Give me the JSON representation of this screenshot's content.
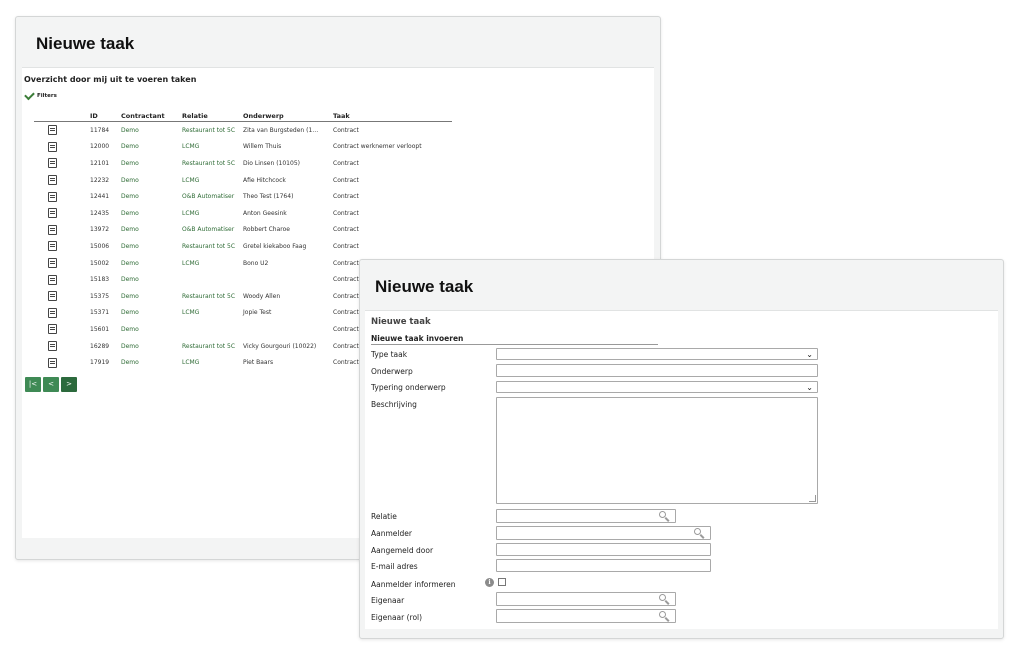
{
  "list_window": {
    "title": "Nieuwe taak",
    "overview_title": "Overzicht door mij uit te voeren taken",
    "filters_label": "Filters",
    "columns": [
      "",
      "ID",
      "Contractant",
      "Relatie",
      "Onderwerp",
      "Taak"
    ],
    "rows": [
      {
        "id": "11784",
        "contractant": "Demo",
        "relatie": "Restaurant tot 5C",
        "onderwerp": "Zita van Burgsteden (1…",
        "taak": "Contract"
      },
      {
        "id": "12000",
        "contractant": "Demo",
        "relatie": "LCMG",
        "onderwerp": "Willem Thuis",
        "taak": "Contract werknemer verloopt"
      },
      {
        "id": "12101",
        "contractant": "Demo",
        "relatie": "Restaurant tot 5C",
        "onderwerp": "Dio Linsen (10105)",
        "taak": "Contract"
      },
      {
        "id": "12232",
        "contractant": "Demo",
        "relatie": "LCMG",
        "onderwerp": "Afie Hitchcock",
        "taak": "Contract"
      },
      {
        "id": "12441",
        "contractant": "Demo",
        "relatie": "O&B Automatiser",
        "onderwerp": "Theo Test (1764)",
        "taak": "Contract"
      },
      {
        "id": "12435",
        "contractant": "Demo",
        "relatie": "LCMG",
        "onderwerp": "Anton Geesink",
        "taak": "Contract"
      },
      {
        "id": "13972",
        "contractant": "Demo",
        "relatie": "O&B Automatiser",
        "onderwerp": "Robbert Charoe",
        "taak": "Contract"
      },
      {
        "id": "15006",
        "contractant": "Demo",
        "relatie": "Restaurant tot 5C",
        "onderwerp": "Gretel kiekaboo Faag",
        "taak": "Contract"
      },
      {
        "id": "15002",
        "contractant": "Demo",
        "relatie": "LCMG",
        "onderwerp": "Bono U2",
        "taak": "Contract"
      },
      {
        "id": "15183",
        "contractant": "Demo",
        "relatie": "",
        "onderwerp": "",
        "taak": "Contract"
      },
      {
        "id": "15375",
        "contractant": "Demo",
        "relatie": "Restaurant tot 5C",
        "onderwerp": "Woody Allen",
        "taak": "Contract"
      },
      {
        "id": "15371",
        "contractant": "Demo",
        "relatie": "LCMG",
        "onderwerp": "Jopie Test",
        "taak": "Contract"
      },
      {
        "id": "15601",
        "contractant": "Demo",
        "relatie": "",
        "onderwerp": "",
        "taak": "Contract"
      },
      {
        "id": "16289",
        "contractant": "Demo",
        "relatie": "Restaurant tot 5C",
        "onderwerp": "Vicky Gourgouri (10022)",
        "taak": "Contract"
      },
      {
        "id": "17919",
        "contractant": "Demo",
        "relatie": "LCMG",
        "onderwerp": "Piet Baars",
        "taak": "Contract"
      }
    ],
    "pager": {
      "first": "|<",
      "prev": "<",
      "next": ">"
    }
  },
  "form_window": {
    "title": "Nieuwe taak",
    "form_title": "Nieuwe taak",
    "section_title": "Nieuwe taak invoeren",
    "labels": {
      "type_taak": "Type taak",
      "onderwerp": "Onderwerp",
      "typering_onderwerp": "Typering onderwerp",
      "beschrijving": "Beschrijving",
      "relatie": "Relatie",
      "aanmelder": "Aanmelder",
      "aangemeld_door": "Aangemeld door",
      "email": "E-mail adres",
      "aanmelder_informeren": "Aanmelder informeren",
      "eigenaar": "Eigenaar",
      "eigenaar_rol": "Eigenaar (rol)"
    },
    "values": {
      "type_taak": "",
      "onderwerp": "",
      "typering_onderwerp": "",
      "beschrijving": "",
      "relatie": "",
      "aanmelder": "",
      "aangemeld_door": "",
      "email": "",
      "eigenaar": "",
      "eigenaar_rol": ""
    },
    "aanmelder_informeren_checked": false
  },
  "colors": {
    "accent_green": "#3f8a55",
    "link_green": "#2e6b35",
    "window_bg": "#f3f4f4"
  }
}
